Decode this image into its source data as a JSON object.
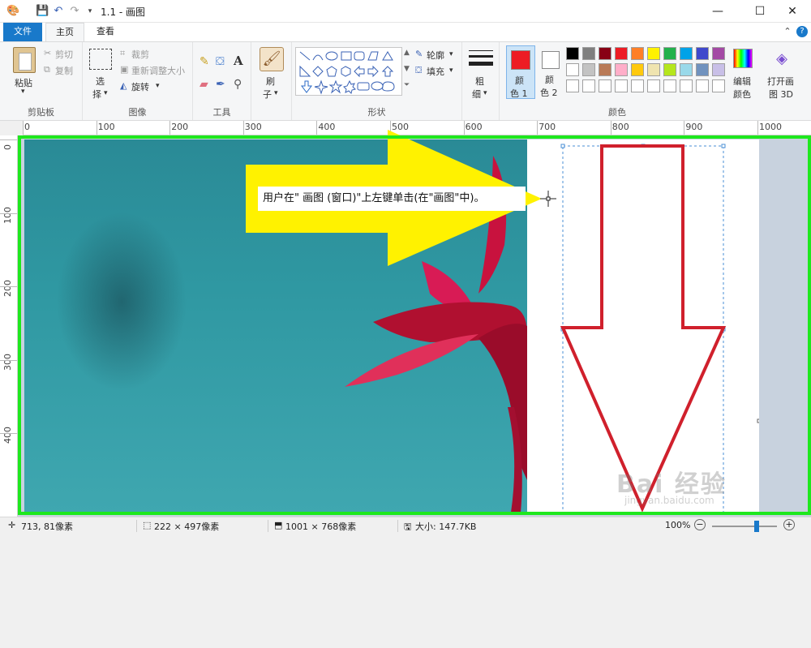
{
  "window": {
    "title": "1.1 - 画图",
    "minimize_glyph": "—",
    "maximize_glyph": "☐",
    "close_glyph": "✕"
  },
  "tabs": {
    "file": "文件",
    "home": "主页",
    "view": "查看"
  },
  "ribbon": {
    "clipboard": {
      "label": "剪贴板",
      "paste": "粘贴",
      "cut": "剪切",
      "copy": "复制"
    },
    "image": {
      "label": "图像",
      "select": "选",
      "select2": "择",
      "crop": "裁剪",
      "resize": "重新调整大小",
      "rotate": "旋转"
    },
    "tools": {
      "label": "工具"
    },
    "brush": {
      "line1": "刷",
      "line2": "子"
    },
    "shapes": {
      "label": "形状",
      "outline": "轮廓",
      "fill": "填充"
    },
    "size": {
      "line1": "粗",
      "line2": "细"
    },
    "colors": {
      "label": "颜色",
      "color1_line1": "颜",
      "color1_line2": "色 1",
      "color2_line1": "颜",
      "color2_line2": "色 2",
      "edit_line1": "编辑",
      "edit_line2": "颜色",
      "paint3d_line1": "打开画",
      "paint3d_line2": "图 3D",
      "color1_value": "#ed1c24",
      "color2_value": "#ffffff",
      "palette_row1": [
        "#000000",
        "#7f7f7f",
        "#880015",
        "#ed1c24",
        "#ff7f27",
        "#fff200",
        "#22b14c",
        "#00a2e8",
        "#3f48cc",
        "#a349a4"
      ],
      "palette_row2": [
        "#ffffff",
        "#c3c3c3",
        "#b97a57",
        "#ffaec9",
        "#ffc90e",
        "#efe4b0",
        "#b5e61d",
        "#99d9ea",
        "#7092be",
        "#c8bfe7"
      ]
    }
  },
  "ruler": {
    "h_ticks": [
      "0",
      "100",
      "200",
      "300",
      "400",
      "500",
      "600",
      "700",
      "800",
      "900",
      "1000"
    ],
    "v_ticks": [
      "0",
      "100",
      "200",
      "300",
      "400"
    ]
  },
  "annotation": {
    "callout": "用户在\" 画图 (窗口)\"上左键单击(在\"画图\"中)。",
    "highlight_color": "#1ee81e",
    "arrow_color": "#fff200"
  },
  "status": {
    "cursor_pos": "713, 81像素",
    "selection_size": "222 × 497像素",
    "image_size": "1001 × 768像素",
    "file_size": "大小: 147.7KB",
    "zoom": "100%",
    "zoom_level_fraction": 0.7
  },
  "watermark": {
    "text": "Bai 经验",
    "sub": "jingyan.baidu.com"
  }
}
